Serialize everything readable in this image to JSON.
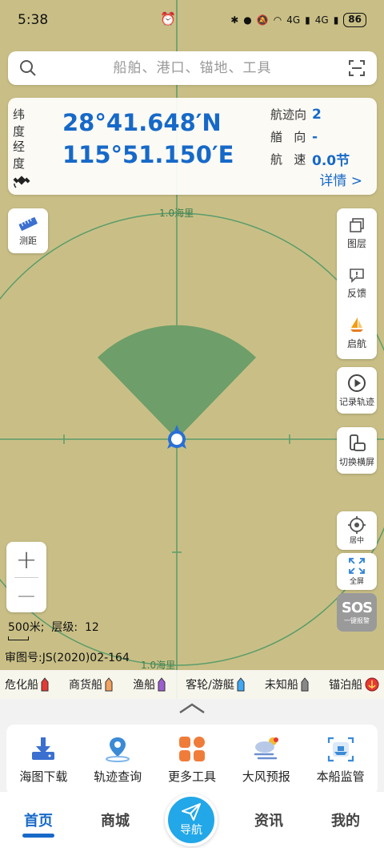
{
  "status": {
    "time": "5:38",
    "battery": "86",
    "net1": "4G",
    "net2": "4G"
  },
  "search": {
    "placeholder": "船舶、港口、锚地、工具"
  },
  "info": {
    "lat_label": "纬 度",
    "lat_value": "28°41.648′N",
    "lon_label": "经 度",
    "lon_value": "115°51.150′E",
    "course_label": "航迹向",
    "course_value": "2",
    "heading_label": "艏   向",
    "heading_value": "-",
    "speed_label": "航   速",
    "speed_value": "0.0节",
    "detail_link": "详情 >"
  },
  "map": {
    "range_label_top": "1.0海里",
    "range_label_bottom": "1.0海里"
  },
  "left_tools": {
    "measure": "测距"
  },
  "right_tools": {
    "layers": "图层",
    "feedback": "反馈",
    "sail": "启航",
    "record_track": "记录轨迹",
    "landscape": "切换横屏",
    "center": "居中",
    "fullscreen": "全屏"
  },
  "sos": {
    "title": "SOS",
    "sub": "一键报警"
  },
  "zoom": {
    "in": "+",
    "out": "—"
  },
  "scale": {
    "text": "500米;  层级:  12"
  },
  "chart_no": "审图号:JS(2020)02-164",
  "legend": [
    {
      "label": "危化船",
      "color": "#e53935"
    },
    {
      "label": "商货船",
      "color": "#f4a261"
    },
    {
      "label": "渔船",
      "color": "#9c5fcf"
    },
    {
      "label": "客轮/游艇",
      "color": "#3fa9f5"
    },
    {
      "label": "未知船",
      "color": "#888888"
    },
    {
      "label": "锚泊船",
      "color": "#e53935"
    }
  ],
  "tools": [
    {
      "label": "海图下载",
      "icon": "download-icon"
    },
    {
      "label": "轨迹查询",
      "icon": "track-query-icon"
    },
    {
      "label": "更多工具",
      "icon": "more-tools-icon"
    },
    {
      "label": "大风预报",
      "icon": "wind-forecast-icon"
    },
    {
      "label": "本船监管",
      "icon": "ship-monitor-icon"
    }
  ],
  "tabs": [
    {
      "label": "首页"
    },
    {
      "label": "商城"
    },
    {
      "label": "导航"
    },
    {
      "label": "资讯"
    },
    {
      "label": "我的"
    }
  ],
  "colors": {
    "accent": "#1769c8",
    "map_bg": "#c9bf86",
    "sector": "#6e9e6a",
    "grid": "#5a9c6a"
  }
}
